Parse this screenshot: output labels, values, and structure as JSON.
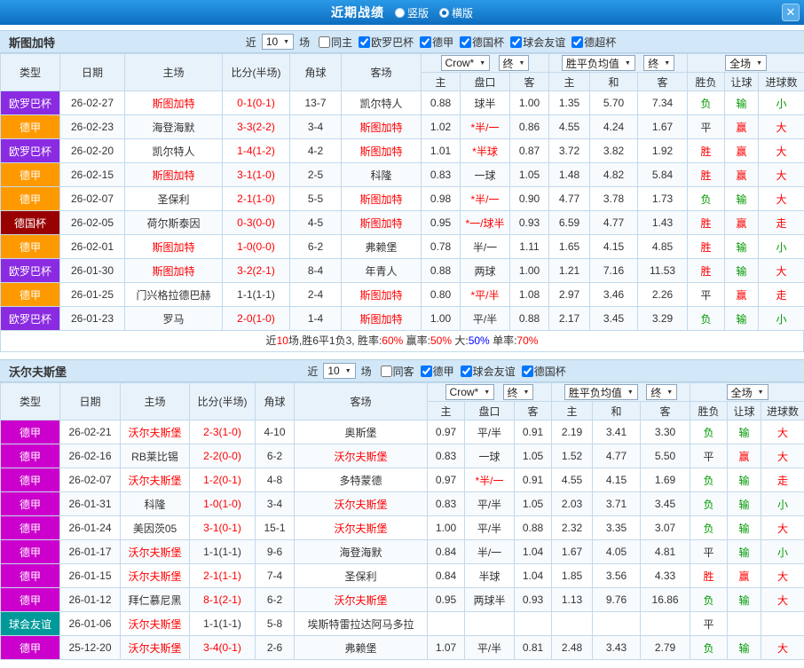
{
  "topbar": {
    "title": "近期战绩",
    "modes": [
      {
        "label": "竖版",
        "selected": false
      },
      {
        "label": "横版",
        "selected": true
      }
    ],
    "close_icon": "✕"
  },
  "filter_labels": {
    "near": "近",
    "unit": "场"
  },
  "table_columns": {
    "main": [
      "类型",
      "日期",
      "主场",
      "比分(半场)",
      "角球",
      "客场"
    ],
    "sub": [
      "主",
      "盘口",
      "客",
      "主",
      "和",
      "客",
      "胜负",
      "让球",
      "进球数"
    ]
  },
  "sections": [
    {
      "team": "斯图加特",
      "near_count": "10",
      "checkboxes": [
        {
          "label": "同主",
          "checked": false
        },
        {
          "label": "欧罗巴杯",
          "checked": true
        },
        {
          "label": "德甲",
          "checked": true
        },
        {
          "label": "德国杯",
          "checked": true
        },
        {
          "label": "球会友谊",
          "checked": true
        },
        {
          "label": "德超杯",
          "checked": true
        }
      ],
      "dropdowns": {
        "book": "Crow*",
        "final1": "终",
        "mean": "胜平负均值",
        "final2": "终",
        "scope": "全场"
      },
      "rows": [
        {
          "type": "欧罗巴杯",
          "type_color": "#8a2be2",
          "date": "26-02-27",
          "home": "斯图加特",
          "home_color": "#ff0000",
          "score": "0-1(0-1)",
          "score_color": "#ff0000",
          "corner": "13-7",
          "away": "凯尔特人",
          "away_color": "#333333",
          "odds_home": "0.88",
          "handicap": "球半",
          "handicap_color": "#333333",
          "odds_away": "1.00",
          "euro_home": "1.35",
          "euro_draw": "5.70",
          "euro_away": "7.34",
          "result": "负",
          "result_color": "#009900",
          "handicap_result": "输",
          "handicap_result_color": "#009900",
          "goals_result": "小",
          "goals_result_color": "#009900"
        },
        {
          "type": "德甲",
          "type_color": "#ff9900",
          "date": "26-02-23",
          "home": "海登海默",
          "home_color": "#333333",
          "score": "3-3(2-2)",
          "score_color": "#ff0000",
          "corner": "3-4",
          "away": "斯图加特",
          "away_color": "#ff0000",
          "odds_home": "1.02",
          "handicap": "*半/一",
          "handicap_color": "#ff0000",
          "odds_away": "0.86",
          "euro_home": "4.55",
          "euro_draw": "4.24",
          "euro_away": "1.67",
          "result": "平",
          "result_color": "#333333",
          "handicap_result": "赢",
          "handicap_result_color": "#ff0000",
          "goals_result": "大",
          "goals_result_color": "#ff0000"
        },
        {
          "type": "欧罗巴杯",
          "type_color": "#8a2be2",
          "date": "26-02-20",
          "home": "凯尔特人",
          "home_color": "#333333",
          "score": "1-4(1-2)",
          "score_color": "#ff0000",
          "corner": "4-2",
          "away": "斯图加特",
          "away_color": "#ff0000",
          "odds_home": "1.01",
          "handicap": "*半球",
          "handicap_color": "#ff0000",
          "odds_away": "0.87",
          "euro_home": "3.72",
          "euro_draw": "3.82",
          "euro_away": "1.92",
          "result": "胜",
          "result_color": "#ff0000",
          "handicap_result": "赢",
          "handicap_result_color": "#ff0000",
          "goals_result": "大",
          "goals_result_color": "#ff0000"
        },
        {
          "type": "德甲",
          "type_color": "#ff9900",
          "date": "26-02-15",
          "home": "斯图加特",
          "home_color": "#ff0000",
          "score": "3-1(1-0)",
          "score_color": "#ff0000",
          "corner": "2-5",
          "away": "科隆",
          "away_color": "#333333",
          "odds_home": "0.83",
          "handicap": "一球",
          "handicap_color": "#333333",
          "odds_away": "1.05",
          "euro_home": "1.48",
          "euro_draw": "4.82",
          "euro_away": "5.84",
          "result": "胜",
          "result_color": "#ff0000",
          "handicap_result": "赢",
          "handicap_result_color": "#ff0000",
          "goals_result": "大",
          "goals_result_color": "#ff0000"
        },
        {
          "type": "德甲",
          "type_color": "#ff9900",
          "date": "26-02-07",
          "home": "圣保利",
          "home_color": "#333333",
          "score": "2-1(1-0)",
          "score_color": "#ff0000",
          "corner": "5-5",
          "away": "斯图加特",
          "away_color": "#ff0000",
          "odds_home": "0.98",
          "handicap": "*半/一",
          "handicap_color": "#ff0000",
          "odds_away": "0.90",
          "euro_home": "4.77",
          "euro_draw": "3.78",
          "euro_away": "1.73",
          "result": "负",
          "result_color": "#009900",
          "handicap_result": "输",
          "handicap_result_color": "#009900",
          "goals_result": "大",
          "goals_result_color": "#ff0000"
        },
        {
          "type": "德国杯",
          "type_color": "#990000",
          "date": "26-02-05",
          "home": "荷尔斯泰因",
          "home_color": "#333333",
          "score": "0-3(0-0)",
          "score_color": "#ff0000",
          "corner": "4-5",
          "away": "斯图加特",
          "away_color": "#ff0000",
          "odds_home": "0.95",
          "handicap": "*一/球半",
          "handicap_color": "#ff0000",
          "odds_away": "0.93",
          "euro_home": "6.59",
          "euro_draw": "4.77",
          "euro_away": "1.43",
          "result": "胜",
          "result_color": "#ff0000",
          "handicap_result": "赢",
          "handicap_result_color": "#ff0000",
          "goals_result": "走",
          "goals_result_color": "#ff0000"
        },
        {
          "type": "德甲",
          "type_color": "#ff9900",
          "date": "26-02-01",
          "home": "斯图加特",
          "home_color": "#ff0000",
          "score": "1-0(0-0)",
          "score_color": "#ff0000",
          "corner": "6-2",
          "away": "弗赖堡",
          "away_color": "#333333",
          "odds_home": "0.78",
          "handicap": "半/一",
          "handicap_color": "#333333",
          "odds_away": "1.11",
          "euro_home": "1.65",
          "euro_draw": "4.15",
          "euro_away": "4.85",
          "result": "胜",
          "result_color": "#ff0000",
          "handicap_result": "输",
          "handicap_result_color": "#009900",
          "goals_result": "小",
          "goals_result_color": "#009900"
        },
        {
          "type": "欧罗巴杯",
          "type_color": "#8a2be2",
          "date": "26-01-30",
          "home": "斯图加特",
          "home_color": "#ff0000",
          "score": "3-2(2-1)",
          "score_color": "#ff0000",
          "corner": "8-4",
          "away": "年青人",
          "away_color": "#333333",
          "odds_home": "0.88",
          "handicap": "两球",
          "handicap_color": "#333333",
          "odds_away": "1.00",
          "euro_home": "1.21",
          "euro_draw": "7.16",
          "euro_away": "11.53",
          "result": "胜",
          "result_color": "#ff0000",
          "handicap_result": "输",
          "handicap_result_color": "#009900",
          "goals_result": "大",
          "goals_result_color": "#ff0000"
        },
        {
          "type": "德甲",
          "type_color": "#ff9900",
          "date": "26-01-25",
          "home": "门兴格拉德巴赫",
          "home_color": "#333333",
          "score": "1-1(1-1)",
          "score_color": "#333333",
          "corner": "2-4",
          "away": "斯图加特",
          "away_color": "#ff0000",
          "odds_home": "0.80",
          "handicap": "*平/半",
          "handicap_color": "#ff0000",
          "odds_away": "1.08",
          "euro_home": "2.97",
          "euro_draw": "3.46",
          "euro_away": "2.26",
          "result": "平",
          "result_color": "#333333",
          "handicap_result": "赢",
          "handicap_result_color": "#ff0000",
          "goals_result": "走",
          "goals_result_color": "#ff0000"
        },
        {
          "type": "欧罗巴杯",
          "type_color": "#8a2be2",
          "date": "26-01-23",
          "home": "罗马",
          "home_color": "#333333",
          "score": "2-0(1-0)",
          "score_color": "#ff0000",
          "corner": "1-4",
          "away": "斯图加特",
          "away_color": "#ff0000",
          "odds_home": "1.00",
          "handicap": "平/半",
          "handicap_color": "#333333",
          "odds_away": "0.88",
          "euro_home": "2.17",
          "euro_draw": "3.45",
          "euro_away": "3.29",
          "result": "负",
          "result_color": "#009900",
          "handicap_result": "输",
          "handicap_result_color": "#009900",
          "goals_result": "小",
          "goals_result_color": "#009900"
        }
      ],
      "summary": [
        {
          "text": "近",
          "color": "#333333"
        },
        {
          "text": "10",
          "color": "#ff0000"
        },
        {
          "text": "场,胜6平1负3, ",
          "color": "#333333"
        },
        {
          "text": "胜率:",
          "color": "#333333"
        },
        {
          "text": "60%",
          "color": "#ff0000"
        },
        {
          "text": " 赢率:",
          "color": "#333333"
        },
        {
          "text": "50%",
          "color": "#ff0000"
        },
        {
          "text": " 大:",
          "color": "#333333"
        },
        {
          "text": "50%",
          "color": "#0000ff"
        },
        {
          "text": " 单率:",
          "color": "#333333"
        },
        {
          "text": "70%",
          "color": "#ff0000"
        }
      ]
    },
    {
      "team": "沃尔夫斯堡",
      "near_count": "10",
      "checkboxes": [
        {
          "label": "同客",
          "checked": false
        },
        {
          "label": "德甲",
          "checked": true
        },
        {
          "label": "球会友谊",
          "checked": true
        },
        {
          "label": "德国杯",
          "checked": true
        }
      ],
      "dropdowns": {
        "book": "Crow*",
        "final1": "终",
        "mean": "胜平负均值",
        "final2": "终",
        "scope": "全场"
      },
      "rows": [
        {
          "type": "德甲",
          "type_color": "#cc00cc",
          "date": "26-02-21",
          "home": "沃尔夫斯堡",
          "home_color": "#ff0000",
          "score": "2-3(1-0)",
          "score_color": "#ff0000",
          "corner": "4-10",
          "away": "奥斯堡",
          "away_color": "#333333",
          "odds_home": "0.97",
          "handicap": "平/半",
          "handicap_color": "#333333",
          "odds_away": "0.91",
          "euro_home": "2.19",
          "euro_draw": "3.41",
          "euro_away": "3.30",
          "result": "负",
          "result_color": "#009900",
          "handicap_result": "输",
          "handicap_result_color": "#009900",
          "goals_result": "大",
          "goals_result_color": "#ff0000"
        },
        {
          "type": "德甲",
          "type_color": "#cc00cc",
          "date": "26-02-16",
          "home": "RB莱比锡",
          "home_color": "#333333",
          "score": "2-2(0-0)",
          "score_color": "#ff0000",
          "corner": "6-2",
          "away": "沃尔夫斯堡",
          "away_color": "#ff0000",
          "odds_home": "0.83",
          "handicap": "一球",
          "handicap_color": "#333333",
          "odds_away": "1.05",
          "euro_home": "1.52",
          "euro_draw": "4.77",
          "euro_away": "5.50",
          "result": "平",
          "result_color": "#333333",
          "handicap_result": "赢",
          "handicap_result_color": "#ff0000",
          "goals_result": "大",
          "goals_result_color": "#ff0000"
        },
        {
          "type": "德甲",
          "type_color": "#cc00cc",
          "date": "26-02-07",
          "home": "沃尔夫斯堡",
          "home_color": "#ff0000",
          "score": "1-2(0-1)",
          "score_color": "#ff0000",
          "corner": "4-8",
          "away": "多特蒙德",
          "away_color": "#333333",
          "odds_home": "0.97",
          "handicap": "*半/一",
          "handicap_color": "#ff0000",
          "odds_away": "0.91",
          "euro_home": "4.55",
          "euro_draw": "4.15",
          "euro_away": "1.69",
          "result": "负",
          "result_color": "#009900",
          "handicap_result": "输",
          "handicap_result_color": "#009900",
          "goals_result": "走",
          "goals_result_color": "#ff0000"
        },
        {
          "type": "德甲",
          "type_color": "#cc00cc",
          "date": "26-01-31",
          "home": "科隆",
          "home_color": "#333333",
          "score": "1-0(1-0)",
          "score_color": "#ff0000",
          "corner": "3-4",
          "away": "沃尔夫斯堡",
          "away_color": "#ff0000",
          "odds_home": "0.83",
          "handicap": "平/半",
          "handicap_color": "#333333",
          "odds_away": "1.05",
          "euro_home": "2.03",
          "euro_draw": "3.71",
          "euro_away": "3.45",
          "result": "负",
          "result_color": "#009900",
          "handicap_result": "输",
          "handicap_result_color": "#009900",
          "goals_result": "小",
          "goals_result_color": "#009900"
        },
        {
          "type": "德甲",
          "type_color": "#cc00cc",
          "date": "26-01-24",
          "home": "美因茨05",
          "home_color": "#333333",
          "score": "3-1(0-1)",
          "score_color": "#ff0000",
          "corner": "15-1",
          "away": "沃尔夫斯堡",
          "away_color": "#ff0000",
          "odds_home": "1.00",
          "handicap": "平/半",
          "handicap_color": "#333333",
          "odds_away": "0.88",
          "euro_home": "2.32",
          "euro_draw": "3.35",
          "euro_away": "3.07",
          "result": "负",
          "result_color": "#009900",
          "handicap_result": "输",
          "handicap_result_color": "#009900",
          "goals_result": "大",
          "goals_result_color": "#ff0000"
        },
        {
          "type": "德甲",
          "type_color": "#cc00cc",
          "date": "26-01-17",
          "home": "沃尔夫斯堡",
          "home_color": "#ff0000",
          "score": "1-1(1-1)",
          "score_color": "#333333",
          "corner": "9-6",
          "away": "海登海默",
          "away_color": "#333333",
          "odds_home": "0.84",
          "handicap": "半/一",
          "handicap_color": "#333333",
          "odds_away": "1.04",
          "euro_home": "1.67",
          "euro_draw": "4.05",
          "euro_away": "4.81",
          "result": "平",
          "result_color": "#333333",
          "handicap_result": "输",
          "handicap_result_color": "#009900",
          "goals_result": "小",
          "goals_result_color": "#009900"
        },
        {
          "type": "德甲",
          "type_color": "#cc00cc",
          "date": "26-01-15",
          "home": "沃尔夫斯堡",
          "home_color": "#ff0000",
          "score": "2-1(1-1)",
          "score_color": "#ff0000",
          "corner": "7-4",
          "away": "圣保利",
          "away_color": "#333333",
          "odds_home": "0.84",
          "handicap": "半球",
          "handicap_color": "#333333",
          "odds_away": "1.04",
          "euro_home": "1.85",
          "euro_draw": "3.56",
          "euro_away": "4.33",
          "result": "胜",
          "result_color": "#ff0000",
          "handicap_result": "赢",
          "handicap_result_color": "#ff0000",
          "goals_result": "大",
          "goals_result_color": "#ff0000"
        },
        {
          "type": "德甲",
          "type_color": "#cc00cc",
          "date": "26-01-12",
          "home": "拜仁慕尼黑",
          "home_color": "#333333",
          "score": "8-1(2-1)",
          "score_color": "#ff0000",
          "corner": "6-2",
          "away": "沃尔夫斯堡",
          "away_color": "#ff0000",
          "odds_home": "0.95",
          "handicap": "两球半",
          "handicap_color": "#333333",
          "odds_away": "0.93",
          "euro_home": "1.13",
          "euro_draw": "9.76",
          "euro_away": "16.86",
          "result": "负",
          "result_color": "#009900",
          "handicap_result": "输",
          "handicap_result_color": "#009900",
          "goals_result": "大",
          "goals_result_color": "#ff0000"
        },
        {
          "type": "球会友谊",
          "type_color": "#009999",
          "date": "26-01-06",
          "home": "沃尔夫斯堡",
          "home_color": "#ff0000",
          "score": "1-1(1-1)",
          "score_color": "#333333",
          "corner": "5-8",
          "away": "埃斯特雷拉达阿马多拉",
          "away_color": "#333333",
          "odds_home": "",
          "handicap": "",
          "handicap_color": "#333333",
          "odds_away": "",
          "euro_home": "",
          "euro_draw": "",
          "euro_away": "",
          "result": "平",
          "result_color": "#333333",
          "handicap_result": "",
          "handicap_result_color": "#333333",
          "goals_result": "",
          "goals_result_color": "#333333"
        },
        {
          "type": "德甲",
          "type_color": "#cc00cc",
          "date": "25-12-20",
          "home": "沃尔夫斯堡",
          "home_color": "#ff0000",
          "score": "3-4(0-1)",
          "score_color": "#ff0000",
          "corner": "2-6",
          "away": "弗赖堡",
          "away_color": "#333333",
          "odds_home": "1.07",
          "handicap": "平/半",
          "handicap_color": "#333333",
          "odds_away": "0.81",
          "euro_home": "2.48",
          "euro_draw": "3.43",
          "euro_away": "2.79",
          "result": "负",
          "result_color": "#009900",
          "handicap_result": "输",
          "handicap_result_color": "#009900",
          "goals_result": "大",
          "goals_result_color": "#ff0000"
        }
      ]
    }
  ]
}
